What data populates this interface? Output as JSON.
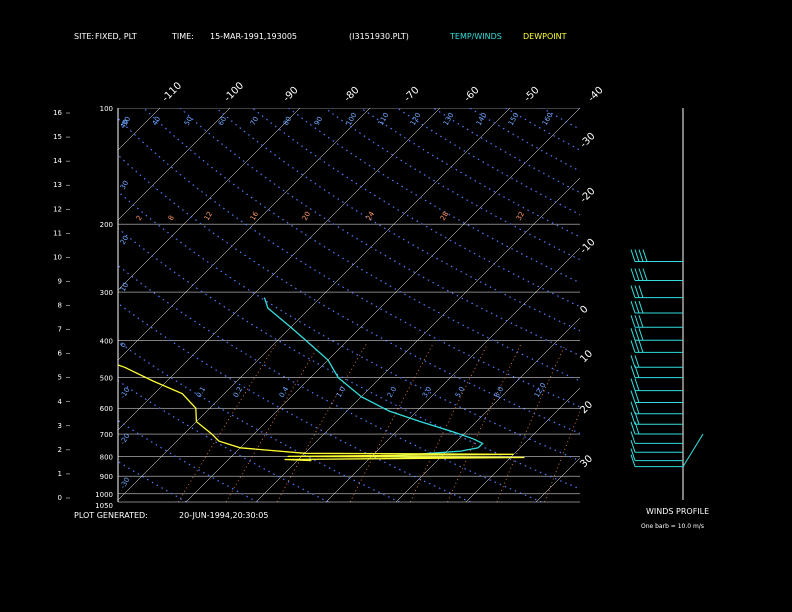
{
  "header": {
    "site_label": "SITE:",
    "site_value": "FIXED, PLT",
    "time_label": "TIME:",
    "time_value": "15-MAR-1991,193005",
    "file": "(I3151930.PLT)",
    "legend_temp": "TEMP/WINDS",
    "legend_dew": "DEWPOINT"
  },
  "footer": {
    "generated_label": "PLOT GENERATED:",
    "generated_value": "20-JUN-1994,20:30:05",
    "winds_title": "WINDS PROFILE",
    "barb_note": "One barb = 10.0 m/s"
  },
  "colors": {
    "temp": "#33dddd",
    "dew": "#ffff33",
    "isobar": "#ffffff",
    "isotherm": "#ffffff",
    "dry_adiabat": "#5577ff",
    "mixing_ratio": "#ff8844",
    "background": "#000000"
  },
  "chart_data": {
    "type": "skew-t",
    "y_pressure_ticks": [
      "100",
      "200",
      "300",
      "400",
      "500",
      "600",
      "700",
      "800",
      "900",
      "1000",
      "1050"
    ],
    "y_height_ticks": [
      "16",
      "15",
      "14",
      "13",
      "12",
      "11",
      "10",
      "9",
      "8",
      "7",
      "6",
      "5",
      "4",
      "3",
      "2",
      "1",
      "0"
    ],
    "temperature_ticks_top": [
      "-110",
      "-100",
      "-90",
      "-80",
      "-70",
      "-60",
      "-50",
      "-40"
    ],
    "temperature_ticks_right": [
      "-30",
      "-20",
      "-10",
      "0",
      "10",
      "20",
      "30"
    ],
    "dry_adiabat_labels": [
      "30",
      "40",
      "50",
      "60",
      "70",
      "80",
      "90",
      "100",
      "110",
      "120",
      "130",
      "140",
      "150",
      "160"
    ],
    "mixing_ratio_labels_upper": [
      "2",
      "8",
      "12",
      "16",
      "20",
      "24",
      "28",
      "32"
    ],
    "mixing_ratio_labels_lower": [
      "0.1",
      "0.2",
      "0.4",
      "1.0",
      "2.0",
      "3.0",
      "5.0",
      "8.0",
      "12.0"
    ],
    "left_potential_labels": [
      "40",
      "30",
      "20",
      "10",
      "0",
      "-10",
      "-20",
      "-30",
      "-40",
      "-50"
    ],
    "temperature_profile": [
      {
        "p": 310,
        "t": -58
      },
      {
        "p": 330,
        "t": -56
      },
      {
        "p": 370,
        "t": -50
      },
      {
        "p": 400,
        "t": -46
      },
      {
        "p": 450,
        "t": -40
      },
      {
        "p": 500,
        "t": -36
      },
      {
        "p": 560,
        "t": -30
      },
      {
        "p": 610,
        "t": -24
      },
      {
        "p": 650,
        "t": -18
      },
      {
        "p": 690,
        "t": -12
      },
      {
        "p": 720,
        "t": -8
      },
      {
        "p": 740,
        "t": -6
      },
      {
        "p": 760,
        "t": -6
      },
      {
        "p": 775,
        "t": -8
      },
      {
        "p": 790,
        "t": -14
      },
      {
        "p": 800,
        "t": -18
      },
      {
        "p": 805,
        "t": -14
      },
      {
        "p": 810,
        "t": -12
      }
    ],
    "dewpoint_profile": [
      {
        "p": 300,
        "t": -86
      },
      {
        "p": 320,
        "t": -84
      },
      {
        "p": 335,
        "t": -80
      },
      {
        "p": 350,
        "t": -80
      },
      {
        "p": 370,
        "t": -84
      },
      {
        "p": 400,
        "t": -82
      },
      {
        "p": 440,
        "t": -74
      },
      {
        "p": 470,
        "t": -68
      },
      {
        "p": 510,
        "t": -62
      },
      {
        "p": 550,
        "t": -56
      },
      {
        "p": 600,
        "t": -52
      },
      {
        "p": 650,
        "t": -50
      },
      {
        "p": 700,
        "t": -46
      },
      {
        "p": 730,
        "t": -44
      },
      {
        "p": 760,
        "t": -40
      },
      {
        "p": 785,
        "t": -30
      },
      {
        "p": 790,
        "t": 0
      },
      {
        "p": 800,
        "t": -32
      },
      {
        "p": 805,
        "t": 2
      },
      {
        "p": 815,
        "t": -32
      },
      {
        "p": 820,
        "t": -28
      }
    ],
    "wind_profile": [
      {
        "p": 250,
        "speed": 40,
        "dir": 310
      },
      {
        "p": 280,
        "speed": 35,
        "dir": 300
      },
      {
        "p": 310,
        "speed": 30,
        "dir": 300
      },
      {
        "p": 340,
        "speed": 30,
        "dir": 290
      },
      {
        "p": 370,
        "speed": 28,
        "dir": 290
      },
      {
        "p": 400,
        "speed": 25,
        "dir": 290
      },
      {
        "p": 430,
        "speed": 25,
        "dir": 280
      },
      {
        "p": 470,
        "speed": 22,
        "dir": 280
      },
      {
        "p": 500,
        "speed": 20,
        "dir": 280
      },
      {
        "p": 540,
        "speed": 20,
        "dir": 280
      },
      {
        "p": 580,
        "speed": 18,
        "dir": 270
      },
      {
        "p": 620,
        "speed": 18,
        "dir": 270
      },
      {
        "p": 660,
        "speed": 15,
        "dir": 270
      },
      {
        "p": 700,
        "speed": 15,
        "dir": 270
      },
      {
        "p": 740,
        "speed": 12,
        "dir": 260
      },
      {
        "p": 780,
        "speed": 10,
        "dir": 260
      },
      {
        "p": 820,
        "speed": 10,
        "dir": 250
      },
      {
        "p": 850,
        "speed": 12,
        "dir": 240
      }
    ],
    "ylim": [
      1050,
      100
    ],
    "y_scale": "log-pressure",
    "grid": true,
    "skew": "45-degree isotherms"
  }
}
